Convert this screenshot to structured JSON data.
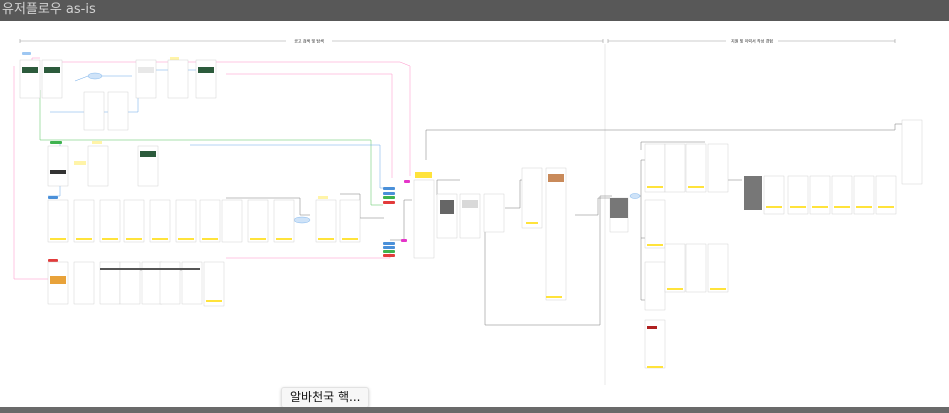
{
  "header": {
    "title": "유저플로우 as-is"
  },
  "sections": [
    {
      "label": "공고 검색 및 탐색"
    },
    {
      "label": "지원 및 이력서 작성 경험"
    }
  ],
  "tooltip": {
    "text": "알바천국 핵..."
  },
  "colors": {
    "titlebar": "#585858",
    "title_text": "#d2d2d2",
    "accent_yellow": "#ffe33b",
    "tag_blue": "#4a90d9",
    "tag_green": "#3fb34f",
    "tag_red": "#e23b3b",
    "tag_pink": "#e535c9",
    "banner_dark": "#2c5b3c"
  }
}
